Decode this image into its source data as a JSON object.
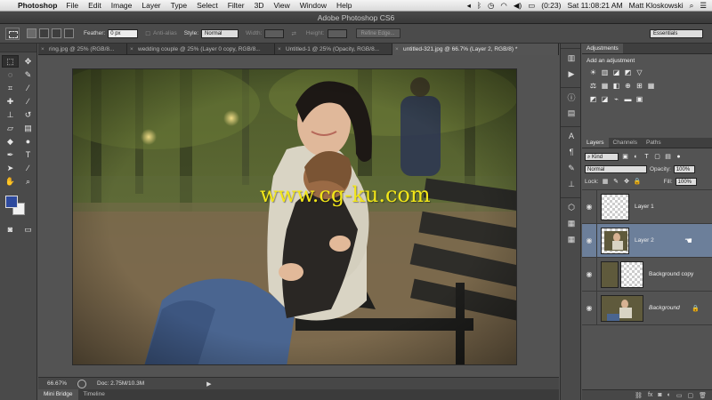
{
  "menubar": {
    "apple": "",
    "app": "Photoshop",
    "items": [
      "File",
      "Edit",
      "Image",
      "Layer",
      "Type",
      "Select",
      "Filter",
      "3D",
      "View",
      "Window",
      "Help"
    ],
    "battery": "(0:23)",
    "clock": "Sat 11:08:21 AM",
    "user": "Matt Kloskowski"
  },
  "window": {
    "title": "Adobe Photoshop CS6"
  },
  "options": {
    "feather_label": "Feather:",
    "feather_value": "0 px",
    "antialias_label": "Anti-alias",
    "style_label": "Style:",
    "style_value": "Normal",
    "width_label": "Width:",
    "height_label": "Height:",
    "refine_edge": "Refine Edge...",
    "workspace": "Essentials"
  },
  "doc_tabs": [
    {
      "label": "ring.jpg @ 25% (RGB/8...",
      "active": false
    },
    {
      "label": "wedding couple @ 25% (Layer 0 copy, RGB/8...",
      "active": false
    },
    {
      "label": "Untitled-1 @ 25% (Opacity, RGB/8...",
      "active": false
    },
    {
      "label": "untitled-321.jpg @ 66.7% (Layer 2, RGB/8) *",
      "active": true
    }
  ],
  "canvas": {
    "watermark": "www.cg-ku.com"
  },
  "status": {
    "zoom": "66.67%",
    "doc": "Doc: 2.75M/10.3M"
  },
  "bottom_tabs": [
    "Mini Bridge",
    "Timeline"
  ],
  "adjustments": {
    "tab": "Adjustments",
    "title": "Add an adjustment",
    "row1": [
      "☀",
      "▥",
      "◪",
      "◩",
      "▽"
    ],
    "row2": [
      "⚖",
      "▦",
      "◧",
      "⊕",
      "⊞",
      "▦"
    ],
    "row3": [
      "◩",
      "◪",
      "⌁",
      "▬",
      "▣"
    ]
  },
  "layers_panel": {
    "tabs": [
      "Layers",
      "Channels",
      "Paths"
    ],
    "kind": "Kind",
    "blend_mode": "Normal",
    "opacity_label": "Opacity:",
    "opacity_value": "100%",
    "lock_label": "Lock:",
    "fill_label": "Fill:",
    "fill_value": "100%",
    "layers": [
      {
        "name": "Layer 1",
        "selected": false
      },
      {
        "name": "Layer 2",
        "selected": true
      },
      {
        "name": "Background copy",
        "selected": false
      },
      {
        "name": "Background",
        "selected": false
      }
    ]
  }
}
